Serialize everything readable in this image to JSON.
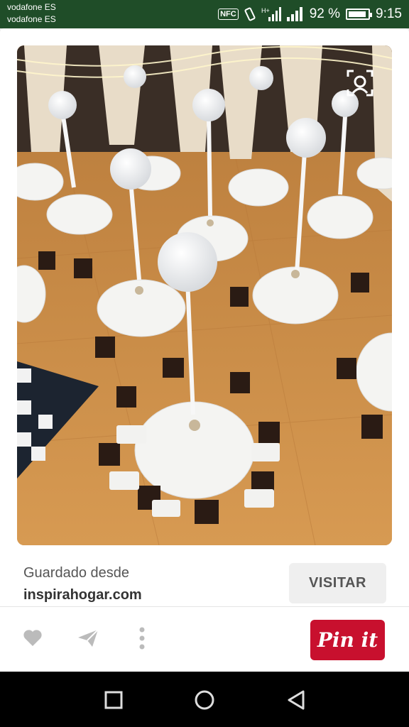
{
  "status_bar": {
    "carrier_1": "vodafone ES",
    "carrier_2": "vodafone ES",
    "nfc": "NFC",
    "network_label": "H+",
    "battery_percent": "92 %",
    "battery_level": 0.92,
    "time": "9:15"
  },
  "pin": {
    "image_description_icon": "visual-search-icon",
    "saved_from_label": "Guardado desde",
    "source_domain": "inspirahogar.com",
    "visit_label": "VISITAR"
  },
  "actions": {
    "like_icon": "heart-icon",
    "send_icon": "send-icon",
    "more_icon": "more-vertical-icon",
    "pinit_label": "Pin it"
  },
  "colors": {
    "status_bar": "#1f4d28",
    "pinit": "#c8102e",
    "visit_bg": "#efefef"
  },
  "nav": {
    "back_icon": "back-icon",
    "home_icon": "home-icon",
    "recent_icon": "recent-apps-icon"
  }
}
